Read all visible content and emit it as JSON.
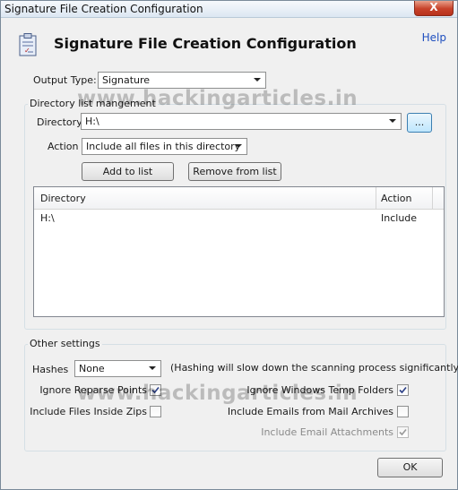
{
  "window": {
    "title": "Signature File Creation Configuration",
    "close_glyph": "X"
  },
  "header": {
    "title": "Signature File Creation Configuration",
    "help_label": "Help",
    "icon": "clipboard-document-icon"
  },
  "output_type": {
    "label": "Output Type:",
    "value": "Signature"
  },
  "directory_group": {
    "legend": "Directory list mangement",
    "directory_label": "Directory",
    "directory_value": "H:\\",
    "browse_label": "...",
    "action_label": "Action",
    "action_value": "Include all files in this directory",
    "add_label": "Add to list",
    "remove_label": "Remove from list",
    "list": {
      "columns": [
        "Directory",
        "Action"
      ],
      "rows": [
        {
          "directory": "H:\\",
          "action": "Include"
        }
      ]
    }
  },
  "other_settings": {
    "legend": "Other settings",
    "hashes_label": "Hashes",
    "hashes_value": "None",
    "hashes_note": "(Hashing will slow down the scanning process significantly)",
    "ignore_reparse": {
      "label": "Ignore Reparse Points",
      "checked": true
    },
    "include_zips": {
      "label": "Include Files Inside Zips",
      "checked": false
    },
    "ignore_temp": {
      "label": "Ignore Windows Temp Folders",
      "checked": true
    },
    "include_mail": {
      "label": "Include Emails from Mail Archives",
      "checked": false
    },
    "include_attachments": {
      "label": "Include Email Attachments",
      "checked": true,
      "disabled": true
    }
  },
  "ok_label": "OK",
  "watermark": "www.hackingarticles.in",
  "colors": {
    "accent_link": "#1f4fbf",
    "close_red": "#c7422a",
    "dialog_bg": "#f0f0f0"
  }
}
